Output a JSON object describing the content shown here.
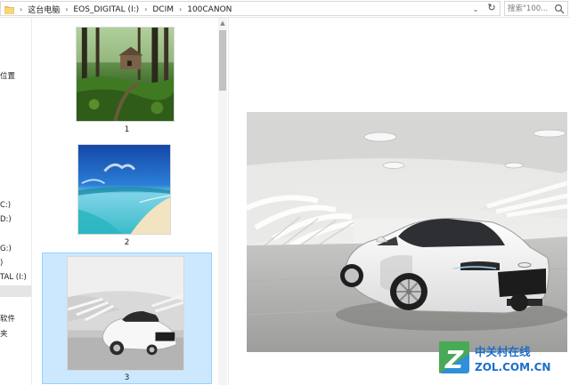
{
  "addressbar": {
    "breadcrumbs": [
      "这台电脑",
      "EOS_DIGITAL (I:)",
      "DCIM",
      "100CANON"
    ],
    "search_placeholder": "搜索\"100..."
  },
  "navpane": {
    "items": [
      {
        "label": "位置",
        "selected": false
      },
      {
        "label": "C:)",
        "selected": false
      },
      {
        "label": "D:)",
        "selected": false
      },
      {
        "label": "G:)",
        "selected": false
      },
      {
        "label": ")",
        "selected": false
      },
      {
        "label": "TAL (I:)",
        "selected": false
      },
      {
        "label": "",
        "selected": true
      },
      {
        "label": "软件",
        "selected": false
      },
      {
        "label": "夹",
        "selected": false
      }
    ]
  },
  "thumbnails": [
    {
      "label": "1",
      "subject": "forest-cabin"
    },
    {
      "label": "2",
      "subject": "tropical-beach"
    },
    {
      "label": "3",
      "subject": "white-sports-car",
      "selected": true
    }
  ],
  "preview": {
    "subject": "white-sports-car"
  },
  "watermark": {
    "logo_letter": "Z",
    "line1": "中关村在线",
    "line2": "ZOL.COM.CN"
  },
  "colors": {
    "selection_bg": "#cce8ff",
    "selection_border": "#99d1ff",
    "watermark_blue": "#1a6fc9",
    "watermark_green": "#4cae3f"
  }
}
